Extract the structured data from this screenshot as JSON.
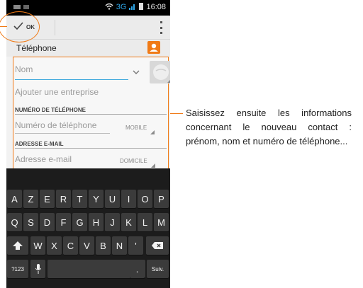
{
  "status_bar": {
    "network": "3G",
    "time": "16:08"
  },
  "action_bar": {
    "ok_label": "OK"
  },
  "account": {
    "label": "Téléphone"
  },
  "form": {
    "name_placeholder": "Nom",
    "company_placeholder": "Ajouter une entreprise",
    "phone_section": "NUMÉRO DE TÉLÉPHONE",
    "phone_placeholder": "Numéro de téléphone",
    "phone_type": "MOBILE",
    "email_section": "ADRESSE E-MAIL",
    "email_placeholder": "Adresse e-mail",
    "email_type": "DOMICILE"
  },
  "keyboard": {
    "row1": [
      "A",
      "Z",
      "E",
      "R",
      "T",
      "Y",
      "U",
      "I",
      "O",
      "P"
    ],
    "row2": [
      "Q",
      "S",
      "D",
      "F",
      "G",
      "H",
      "J",
      "K",
      "L",
      "M"
    ],
    "row3": [
      "W",
      "X",
      "C",
      "V",
      "B",
      "N",
      "'"
    ],
    "mode_key": "?123",
    "next_key": "Suiv.",
    "period_key": "."
  },
  "caption": "Saisissez ensuite les informations concernant le nouveau contact : prénom, nom et numéro de téléphone...",
  "colors": {
    "accent": "#f07a16",
    "focus": "#3fa9dd",
    "network": "#2ea6e8"
  },
  "icons": [
    "checkmark-icon",
    "overflow-menu-icon",
    "account-icon",
    "contact-photo-icon",
    "shift-icon",
    "backspace-icon",
    "microphone-icon",
    "wifi-icon",
    "signal-icon",
    "battery-icon"
  ]
}
